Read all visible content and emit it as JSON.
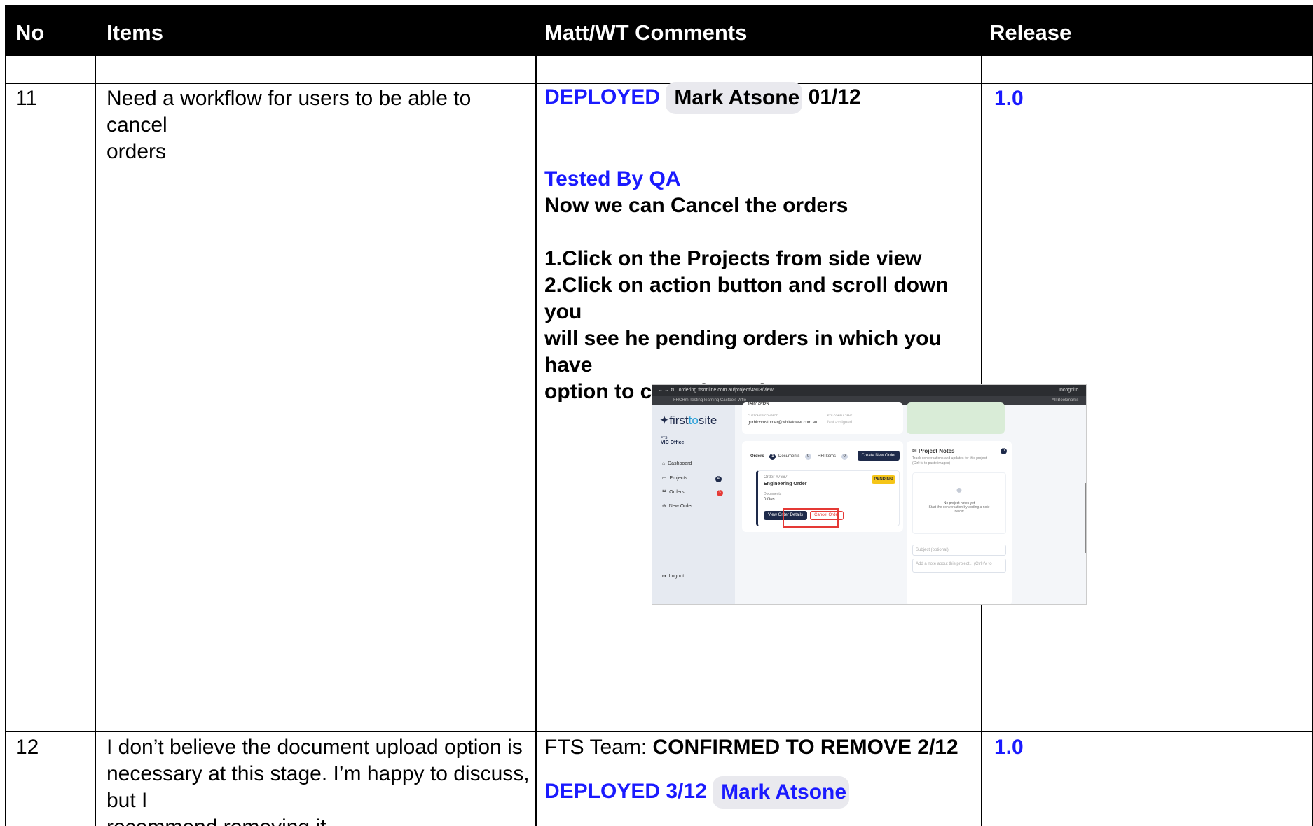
{
  "headers": {
    "no": "No",
    "items": "Items",
    "comments": "Matt/WT Comments",
    "release": "Release"
  },
  "rows": [
    {
      "no": "11",
      "item_line1": "Need a workflow for users to be able to cancel",
      "item_line2": "orders",
      "status": "DEPLOYED",
      "person": "Mark Atsone",
      "date": "01/12",
      "tested": "Tested By QA",
      "summary": "Now we can Cancel the orders",
      "step1": "1.Click on the Projects from side view",
      "step2_l1": "2.Click on action button and scroll down you",
      "step2_l2": "will see he pending orders in which you have",
      "step2_l3": "option to cene the orders",
      "release": "1.0"
    },
    {
      "no": "12",
      "item_line1": "I don’t believe the document upload option is",
      "item_line2": "necessary at this stage. I’m happy to discuss, but I",
      "item_line3": "recommend removing it.",
      "team_label": "FTS Team: ",
      "team_status": "CONFIRMED TO REMOVE 2/12",
      "deployed": "DEPLOYED 3/12",
      "person": "Mark Atsone",
      "release": "1.0"
    }
  ],
  "screenshot": {
    "url": "ordering.ftsonline.com.au/project/4913/view",
    "bookmarks": "FHCRm   Testing learning   Cactools   Wflo",
    "all_bookmarks": "All Bookmarks",
    "incognito": "Incognito",
    "logo_a": "first",
    "logo_b": "to",
    "logo_c": "site",
    "office_code": "FTS",
    "office_name": "VIC Office",
    "nav": [
      "Dashboard",
      "Projects",
      "Orders",
      "New Order"
    ],
    "projects_count": "4",
    "orders_count": "3",
    "logout": "Logout",
    "date": "15/01/2026",
    "customer_contact_label": "CUSTOMER CONTACT",
    "customer_contact": "gurbir+customer@whitetower.com.au",
    "fts_consultant_label": "FTS CONSULTANT",
    "fts_consultant": "Not assigned",
    "tabs": [
      "Orders",
      "Documents",
      "RFI Items"
    ],
    "orders_tab_count": "1",
    "documents_tab_count": "0",
    "rfi_tab_count": "0",
    "create_order": "Create New Order",
    "order_no": "Order #7667",
    "order_title": "Engineering Order",
    "pending": "PENDING",
    "documents_label": "Documents",
    "files": "0 files",
    "view_details": "View Order Details",
    "cancel_order": "Cancel Order",
    "notes_title": "Project Notes",
    "notes_count": "0",
    "notes_sub1": "Track conversations and updates for this project",
    "notes_sub2": "(Ctrl+V to paste images)",
    "no_notes": "No project notes yet",
    "no_notes_sub1": "Start the conversation by adding a note",
    "no_notes_sub2": "below",
    "subject_placeholder": "Subject (optional)",
    "note_placeholder": "Add a note about this project... (Ctrl+V to"
  }
}
